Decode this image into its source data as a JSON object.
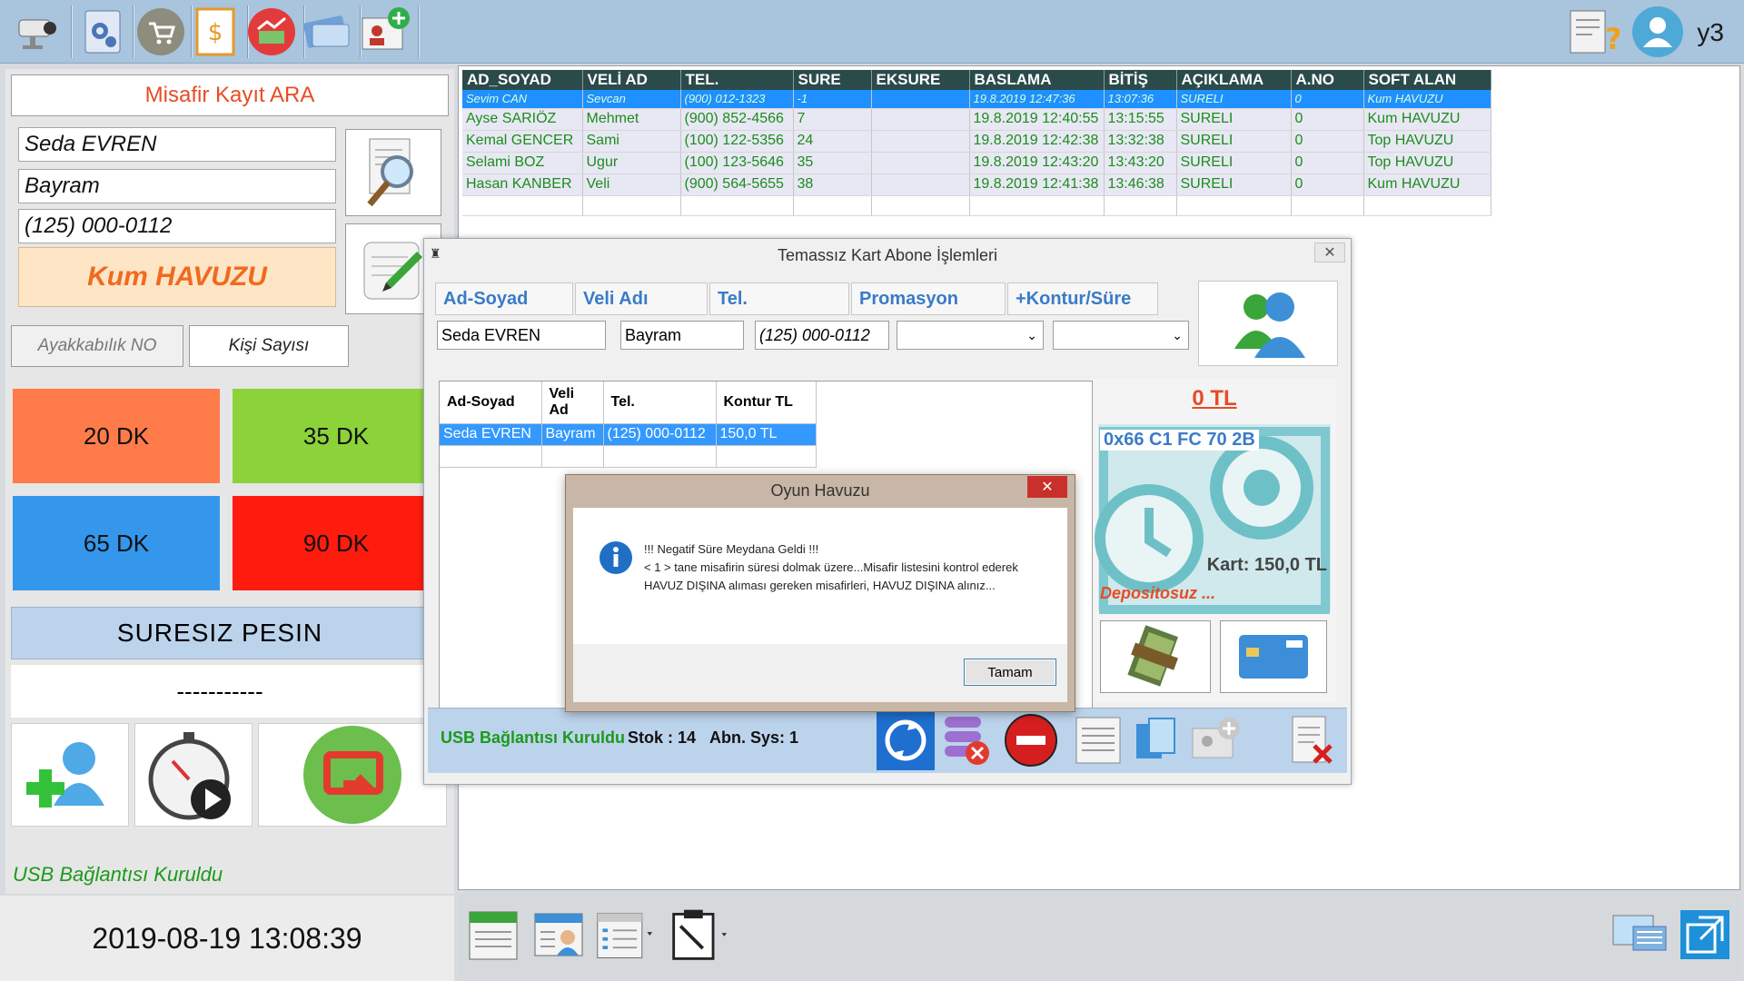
{
  "toolbar": {
    "icons": [
      "camera-icon",
      "settings-gear-icon",
      "cart-icon",
      "invoice-icon",
      "money-chart-icon",
      "payment-card-icon",
      "add-user-card-icon"
    ],
    "user_name": "y3"
  },
  "left_panel": {
    "title": "Misafir Kayıt ARA",
    "name_value": "Seda EVREN",
    "parent_value": "Bayram",
    "phone_value": "(125) 000-0112",
    "area_value": "Kum HAVUZU",
    "shoe_no_placeholder": "Ayakkabılık NO",
    "people_placeholder": "Kişi Sayısı",
    "time_buttons": [
      {
        "label": "20 DK",
        "color": "#ff7b4a"
      },
      {
        "label": "35 DK",
        "color": "#8cd33a"
      },
      {
        "label": "65 DK",
        "color": "#3597ec"
      },
      {
        "label": "90 DK",
        "color": "#ff1b0e"
      }
    ],
    "unlimited_label": "SURESIZ PESIN",
    "dashes": "-----------",
    "usb_status": "USB Bağlantısı Kuruldu"
  },
  "clock": "2019-08-19 13:08:39",
  "grid": {
    "columns": [
      "AD_SOYAD",
      "VELİ AD",
      "TEL.",
      "SURE",
      "EKSURE",
      "BASLAMA",
      "BİTİŞ",
      "AÇIKLAMA",
      "A.NO",
      "SOFT ALAN"
    ],
    "rows": [
      [
        "Sevim CAN",
        "Sevcan",
        "(900) 012-1323",
        "-1",
        "",
        "19.8.2019 12:47:36",
        "13:07:36",
        "SURELI",
        "0",
        "Kum HAVUZU"
      ],
      [
        "Ayse  SARIÖZ",
        "Mehmet",
        "(900) 852-4566",
        "7",
        "",
        "19.8.2019 12:40:55",
        "13:15:55",
        "SURELI",
        "0",
        "Kum HAVUZU"
      ],
      [
        "Kemal GENCER",
        "Sami",
        "(100) 122-5356",
        "24",
        "",
        "19.8.2019 12:42:38",
        "13:32:38",
        "SURELI",
        "0",
        "Top HAVUZU"
      ],
      [
        "Selami BOZ",
        "Ugur",
        "(100) 123-5646",
        "35",
        "",
        "19.8.2019 12:43:20",
        "13:43:20",
        "SURELI",
        "0",
        "Top HAVUZU"
      ],
      [
        "Hasan KANBER",
        "Veli",
        "(900) 564-5655",
        "38",
        "",
        "19.8.2019 12:41:38",
        "13:46:38",
        "SURELI",
        "0",
        "Kum HAVUZU"
      ]
    ]
  },
  "subscriber_window": {
    "title": "Temassız Kart Abone İşlemleri",
    "headers": [
      "Ad-Soyad",
      "Veli Adı",
      "Tel.",
      "Promasyon",
      "+Kontur/Süre"
    ],
    "name_value": "Seda EVREN",
    "parent_value": "Bayram",
    "phone_value": "(125) 000-0112",
    "table_headers": [
      "Ad-Soyad",
      "Veli Ad",
      "Tel.",
      "Kontur TL"
    ],
    "table_rows": [
      [
        "Seda EVREN",
        "Bayram",
        "(125) 000-0112",
        "150,0 TL"
      ]
    ],
    "balance": "0 TL",
    "card_id": "0x66 C1 FC 70 2B",
    "card_balance": "Kart: 150,0 TL",
    "deposit": "Depositosuz ...",
    "usb_status": "USB Bağlantısı Kuruldu",
    "stock": "Stok : 14",
    "abn": "Abn. Sys: 1"
  },
  "dialog": {
    "title": "Oyun Havuzu",
    "line1": "!!! Negatif Süre Meydana Geldi !!!",
    "line2": "< 1 > tane misafirin süresi dolmak üzere...Misafir listesini kontrol ederek HAVUZ DIŞINA alıması gereken misafirleri, HAVUZ DIŞINA alınız...",
    "ok_label": "Tamam"
  }
}
